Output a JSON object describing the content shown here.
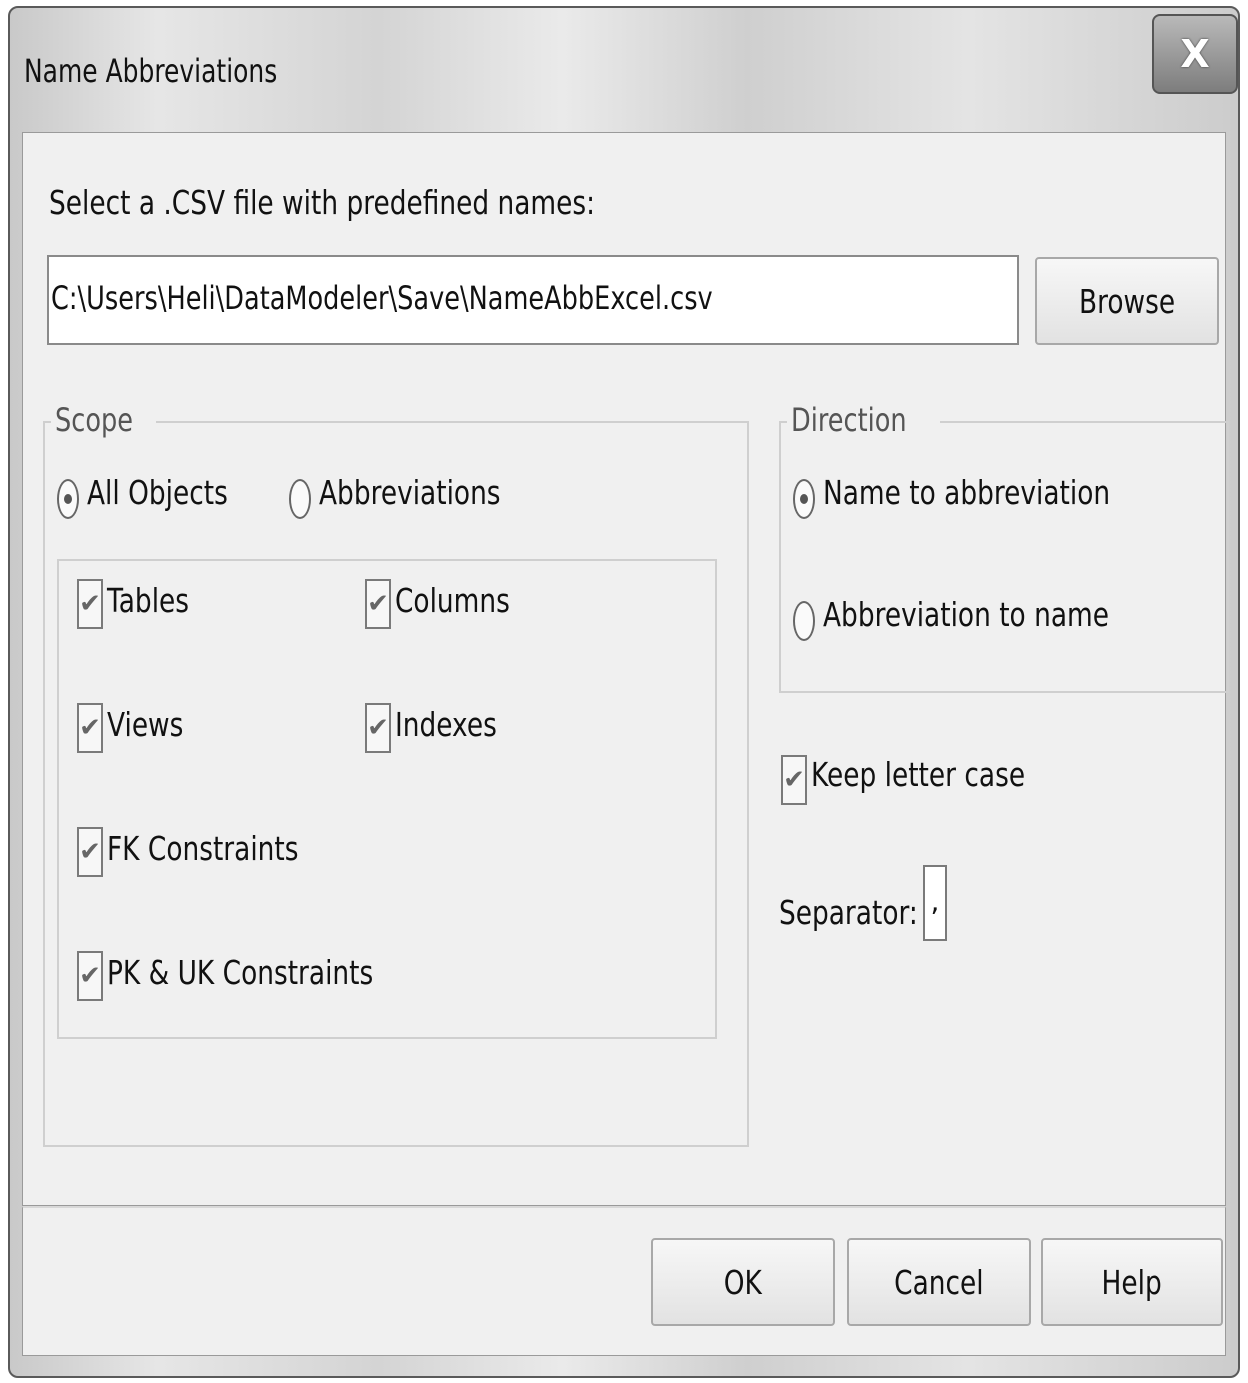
{
  "window": {
    "title": "Name Abbreviations",
    "close_label": "X"
  },
  "file": {
    "label": "Select a .CSV file with predefined names:",
    "path": "C:\\Users\\Heli\\DataModeler\\Save\\NameAbbExcel.csv",
    "browse_label": "Browse"
  },
  "scope": {
    "legend": "Scope",
    "options": [
      {
        "label": "All Objects",
        "selected": true
      },
      {
        "label": "Abbreviations",
        "selected": false
      }
    ],
    "objects": [
      {
        "label": "Tables",
        "checked": true
      },
      {
        "label": "Columns",
        "checked": true
      },
      {
        "label": "Views",
        "checked": true
      },
      {
        "label": "Indexes",
        "checked": true
      },
      {
        "label": "FK Constraints",
        "checked": true
      },
      {
        "label": "PK & UK Constraints",
        "checked": true
      }
    ]
  },
  "direction": {
    "legend": "Direction",
    "options": [
      {
        "label": "Name to abbreviation",
        "selected": true
      },
      {
        "label": "Abbreviation to name",
        "selected": false
      }
    ]
  },
  "keep_case": {
    "label": "Keep letter case",
    "checked": true
  },
  "separator": {
    "label": "Separator:",
    "value": ","
  },
  "footer": {
    "ok_label": "OK",
    "cancel_label": "Cancel",
    "help_label": "Help"
  }
}
